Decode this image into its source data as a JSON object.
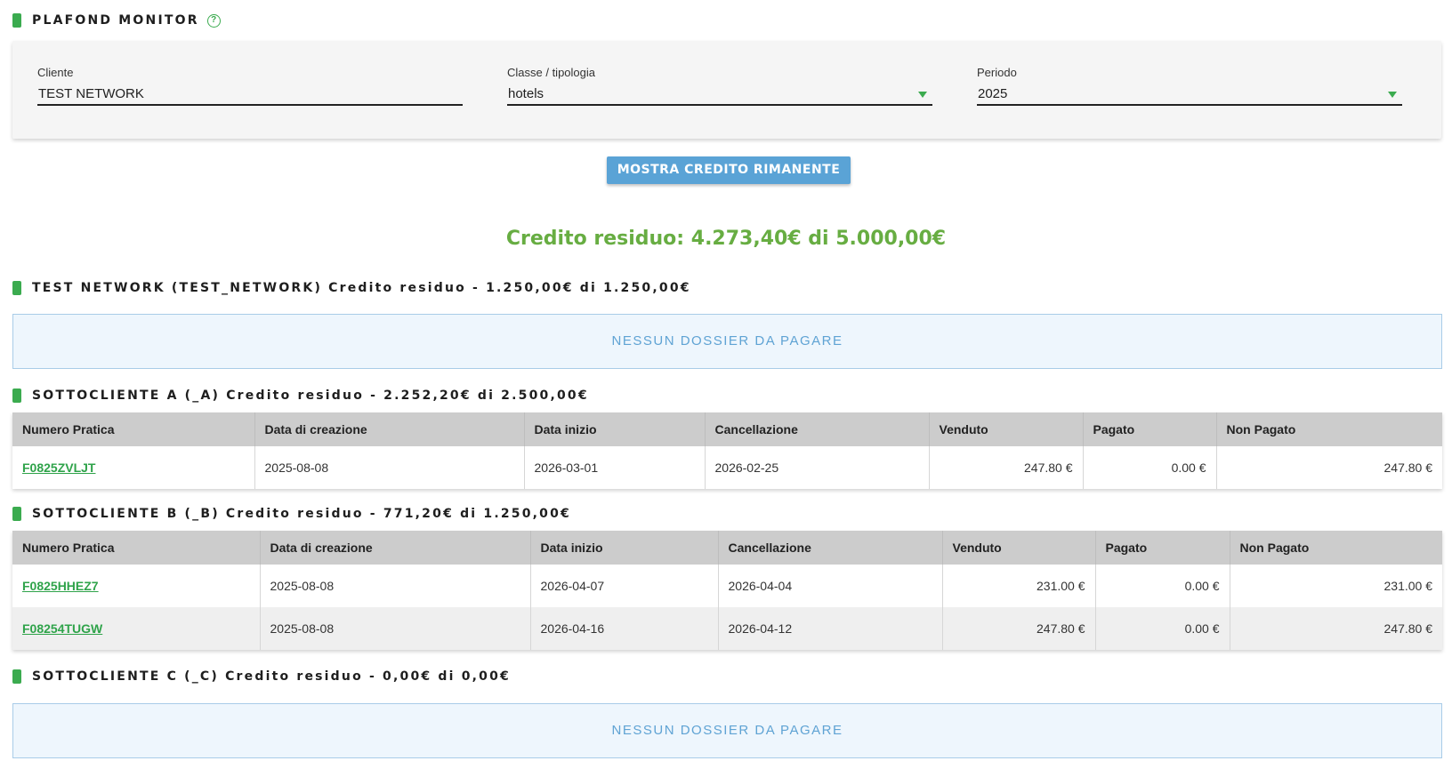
{
  "header": {
    "title": "PLAFOND MONITOR",
    "help_icon": "?"
  },
  "filters": {
    "cliente": {
      "label": "Cliente",
      "value": "TEST NETWORK"
    },
    "classe": {
      "label": "Classe / tipologia",
      "value": "hotels"
    },
    "periodo": {
      "label": "Periodo",
      "value": "2025"
    }
  },
  "action": {
    "show_credit_label": "MOSTRA CREDITO RIMANENTE"
  },
  "credit_total": "Credito residuo: 4.273,40€ di 5.000,00€",
  "empty_message": "NESSUN DOSSIER DA PAGARE",
  "columns": [
    "Numero Pratica",
    "Data di creazione",
    "Data inizio",
    "Cancellazione",
    "Venduto",
    "Pagato",
    "Non Pagato"
  ],
  "sections": {
    "network": {
      "title": "TEST NETWORK (TEST_NETWORK) Credito residuo - 1.250,00€ di 1.250,00€"
    },
    "sub_a": {
      "title": "SOTTOCLIENTE A (_A) Credito residuo - 2.252,20€ di 2.500,00€",
      "rows": [
        {
          "numero": "F0825ZVLJT",
          "creazione": "2025-08-08",
          "inizio": "2026-03-01",
          "cancellazione": "2026-02-25",
          "venduto": "247.80 €",
          "pagato": "0.00 €",
          "non_pagato": "247.80 €"
        }
      ]
    },
    "sub_b": {
      "title": "SOTTOCLIENTE B (_B) Credito residuo - 771,20€ di 1.250,00€",
      "rows": [
        {
          "numero": "F0825HHEZ7",
          "creazione": "2025-08-08",
          "inizio": "2026-04-07",
          "cancellazione": "2026-04-04",
          "venduto": "231.00 €",
          "pagato": "0.00 €",
          "non_pagato": "231.00 €"
        },
        {
          "numero": "F08254TUGW",
          "creazione": "2025-08-08",
          "inizio": "2026-04-16",
          "cancellazione": "2026-04-12",
          "venduto": "247.80 €",
          "pagato": "0.00 €",
          "non_pagato": "247.80 €"
        }
      ]
    },
    "sub_c": {
      "title": "SOTTOCLIENTE C (_C) Credito residuo - 0,00€ di 0,00€"
    }
  },
  "colors": {
    "accent_green": "#3bab4f",
    "credit_green": "#67ad42",
    "button_blue": "#5aa3d6",
    "empty_bg": "#eef6fd"
  }
}
